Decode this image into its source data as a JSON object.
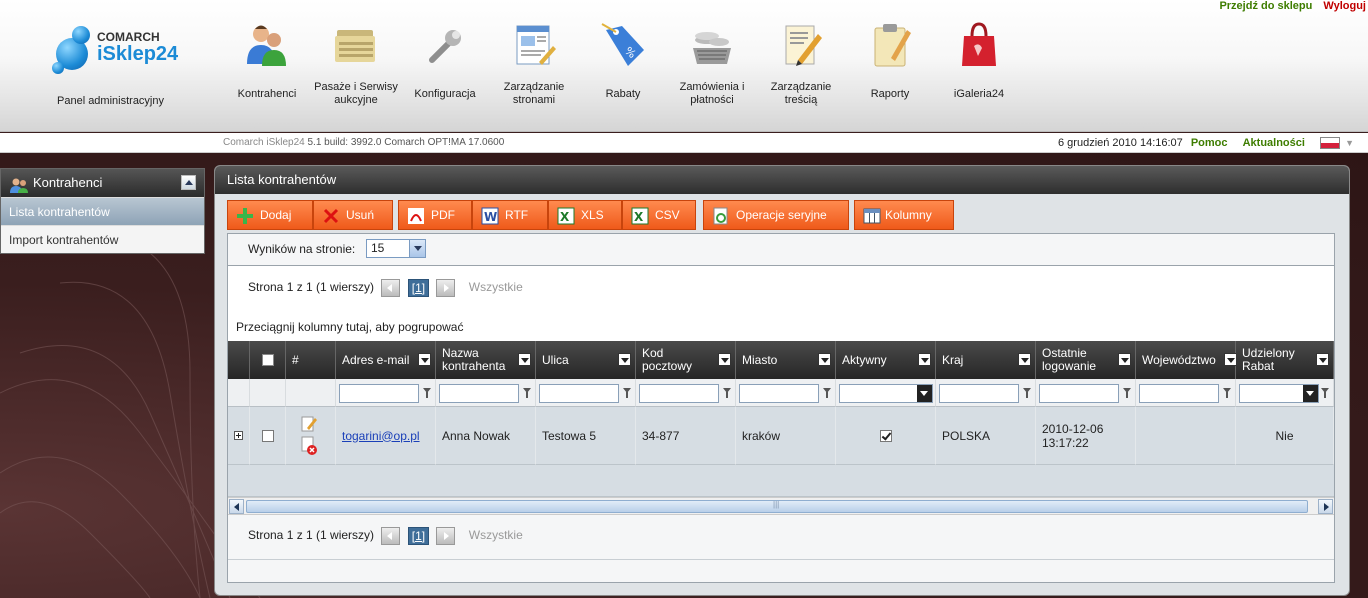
{
  "top_links": {
    "go_to_shop": "Przejdź do sklepu",
    "logout": "Wyloguj"
  },
  "logo": {
    "brand": "COMARCH",
    "product": "iSklep24"
  },
  "panel_label": "Panel administracyjny",
  "nav": [
    {
      "label": "Kontrahenci",
      "icon": "contractors-icon"
    },
    {
      "label": "Pasaże i Serwisy aukcyjne",
      "icon": "folders-icon"
    },
    {
      "label": "Konfiguracja",
      "icon": "wrench-icon"
    },
    {
      "label": "Zarządzanie stronami",
      "icon": "pages-icon"
    },
    {
      "label": "Rabaty",
      "icon": "discount-tag-icon"
    },
    {
      "label": "Zamówienia i płatności",
      "icon": "coins-basket-icon"
    },
    {
      "label": "Zarządzanie treścią",
      "icon": "content-edit-icon"
    },
    {
      "label": "Raporty",
      "icon": "clipboard-icon"
    },
    {
      "label": "iGaleria24",
      "icon": "shopping-bag-icon"
    }
  ],
  "infobar": {
    "app_name": "Comarch iSklep24",
    "build": "5.1 build: 3992.0",
    "erp": "Comarch OPT!MA 17.0600",
    "datetime": "6 grudzień 2010 14:16:07",
    "help": "Pomoc",
    "news": "Aktualności"
  },
  "sidebar": {
    "title": "Kontrahenci",
    "items": [
      {
        "label": "Lista kontrahentów",
        "active": true
      },
      {
        "label": "Import kontrahentów",
        "active": false
      }
    ]
  },
  "main": {
    "title": "Lista kontrahentów",
    "toolbar": {
      "add": "Dodaj",
      "delete": "Usuń",
      "pdf": "PDF",
      "rtf": "RTF",
      "xls": "XLS",
      "csv": "CSV",
      "bulk": "Operacje seryjne",
      "columns": "Kolumny"
    },
    "per_page_label": "Wyników na stronie:",
    "per_page_value": "15",
    "pager_text": "Strona 1 z 1 (1 wierszy)",
    "pager_current": "[1]",
    "pager_all": "Wszystkie",
    "group_hint": "Przeciągnij kolumny tutaj, aby pogrupować",
    "columns": [
      "#",
      "Adres e-mail",
      "Nazwa kontrahenta",
      "Ulica",
      "Kod pocztowy",
      "Miasto",
      "Aktywny",
      "Kraj",
      "Ostatnie logowanie",
      "Województwo",
      "Udzielony Rabat"
    ],
    "rows": [
      {
        "email": "togarini@op.pl",
        "name": "Anna Nowak",
        "street": "Testowa 5",
        "postal": "34-877",
        "city": "kraków",
        "active": true,
        "country": "POLSKA",
        "last_login": "2010-12-06 13:17:22",
        "province": "",
        "discount": "Nie"
      }
    ]
  }
}
